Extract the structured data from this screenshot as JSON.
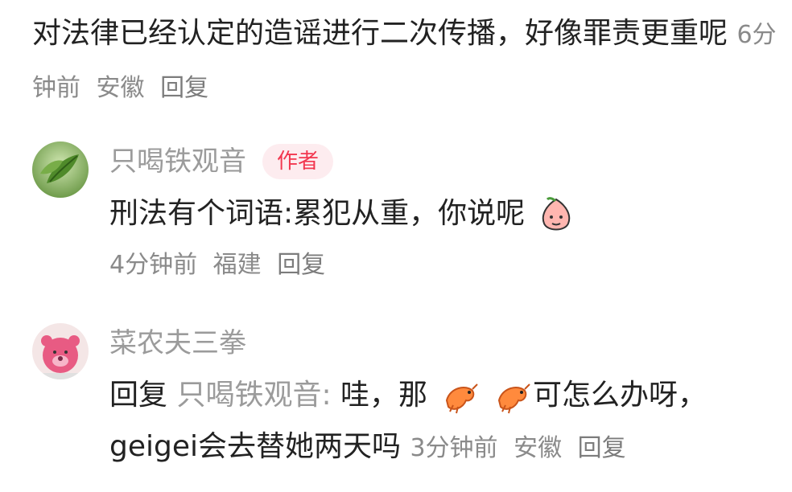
{
  "top_comment": {
    "text": "对法律已经认定的造谣进行二次传播，好像罪责更重呢",
    "time": "6分钟前",
    "location": "安徽",
    "reply_label": "回复"
  },
  "replies": [
    {
      "nickname": "只喝铁观音",
      "badge": "作者",
      "text": "刑法有个词语:累犯从重，你说呢",
      "emoji": "peach-face-emoji",
      "time": "4分钟前",
      "location": "福建",
      "reply_label": "回复"
    },
    {
      "nickname": "菜农夫三拳",
      "reply_prefix": "回复",
      "reply_target": "只喝铁观音:",
      "text_before_emoji": " 哇，那",
      "emoji": "shrimp-emoji",
      "text_after_emoji": "可怎么办呀，geigei会去替她两天吗",
      "time": "3分钟前",
      "location": "安徽",
      "reply_label": "回复"
    }
  ]
}
